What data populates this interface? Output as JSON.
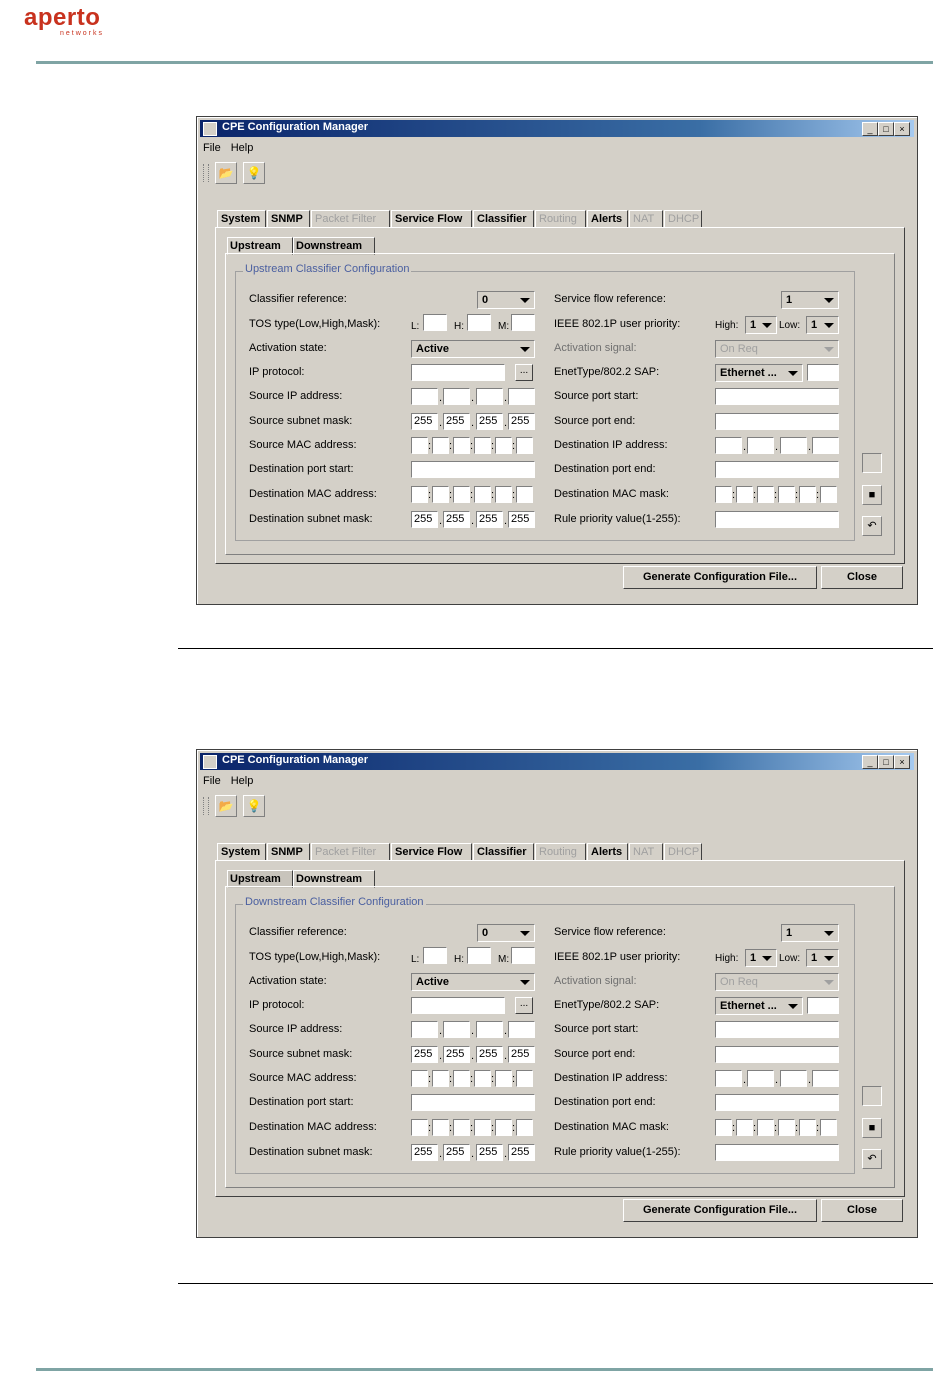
{
  "logo": {
    "name": "aperto",
    "sub": "networks"
  },
  "windows": [
    {
      "title": "CPE Configuration Manager",
      "menu": [
        "File",
        "Help"
      ],
      "tabs": [
        {
          "label": "System",
          "enabled": true
        },
        {
          "label": "SNMP",
          "enabled": true
        },
        {
          "label": "Packet Filter",
          "enabled": false
        },
        {
          "label": "Service Flow",
          "enabled": true
        },
        {
          "label": "Classifier",
          "enabled": true
        },
        {
          "label": "Routing",
          "enabled": false
        },
        {
          "label": "Alerts",
          "enabled": true
        },
        {
          "label": "NAT",
          "enabled": false
        },
        {
          "label": "DHCP",
          "enabled": false
        }
      ],
      "subtabs": [
        {
          "label": "Upstream",
          "selected": true
        },
        {
          "label": "Downstream",
          "selected": false
        }
      ],
      "group_title": "Upstream Classifier Configuration",
      "labels_left": [
        "Classifier reference:",
        "TOS type(Low,High,Mask):",
        "Activation state:",
        "IP protocol:",
        "Source IP address:",
        "Source subnet mask:",
        "Source MAC address:",
        "Destination port start:",
        "Destination MAC address:",
        "Destination subnet mask:"
      ],
      "labels_right": [
        "Service flow reference:",
        "IEEE 802.1P user priority:",
        "Activation signal:",
        "EnetType/802.2 SAP:",
        "Source port start:",
        "Source port end:",
        "Destination IP address:",
        "Destination port end:",
        "Destination MAC mask:",
        "Rule priority value(1-255):"
      ],
      "classifier_reference": "0",
      "service_flow_reference": "1",
      "tos": {
        "low_label": "L:",
        "high_label": "H:",
        "mask_label": "M:"
      },
      "priority": {
        "high_label": "High:",
        "high": "1",
        "low_label": "Low:",
        "low": "1"
      },
      "activation_state": "Active",
      "activation_signal": "On Req",
      "enettype": "Ethernet ...",
      "ellipsis": "...",
      "source_subnet_mask": [
        "255",
        "255",
        "255",
        "255"
      ],
      "destination_subnet_mask": [
        "255",
        "255",
        "255",
        "255"
      ],
      "generate_label": "Generate Configuration File...",
      "close_label": "Close"
    },
    {
      "title": "CPE Configuration Manager",
      "menu": [
        "File",
        "Help"
      ],
      "tabs": [
        {
          "label": "System",
          "enabled": true
        },
        {
          "label": "SNMP",
          "enabled": true
        },
        {
          "label": "Packet Filter",
          "enabled": false
        },
        {
          "label": "Service Flow",
          "enabled": true
        },
        {
          "label": "Classifier",
          "enabled": true
        },
        {
          "label": "Routing",
          "enabled": false
        },
        {
          "label": "Alerts",
          "enabled": true
        },
        {
          "label": "NAT",
          "enabled": false
        },
        {
          "label": "DHCP",
          "enabled": false
        }
      ],
      "subtabs": [
        {
          "label": "Upstream",
          "selected": false
        },
        {
          "label": "Downstream",
          "selected": true
        }
      ],
      "group_title": "Downstream Classifier Configuration",
      "labels_left": [
        "Classifier reference:",
        "TOS type(Low,High,Mask):",
        "Activation state:",
        "IP protocol:",
        "Source IP address:",
        "Source subnet mask:",
        "Source MAC address:",
        "Destination port start:",
        "Destination MAC address:",
        "Destination subnet mask:"
      ],
      "labels_right": [
        "Service flow reference:",
        "IEEE 802.1P user priority:",
        "Activation signal:",
        "EnetType/802.2 SAP:",
        "Source port start:",
        "Source port end:",
        "Destination IP address:",
        "Destination port end:",
        "Destination MAC mask:",
        "Rule priority value(1-255):"
      ],
      "classifier_reference": "0",
      "service_flow_reference": "1",
      "tos": {
        "low_label": "L:",
        "high_label": "H:",
        "mask_label": "M:"
      },
      "priority": {
        "high_label": "High:",
        "high": "1",
        "low_label": "Low:",
        "low": "1"
      },
      "activation_state": "Active",
      "activation_signal": "On Req",
      "enettype": "Ethernet ...",
      "ellipsis": "...",
      "source_subnet_mask": [
        "255",
        "255",
        "255",
        "255"
      ],
      "destination_subnet_mask": [
        "255",
        "255",
        "255",
        "255"
      ],
      "generate_label": "Generate Configuration File...",
      "close_label": "Close"
    }
  ]
}
